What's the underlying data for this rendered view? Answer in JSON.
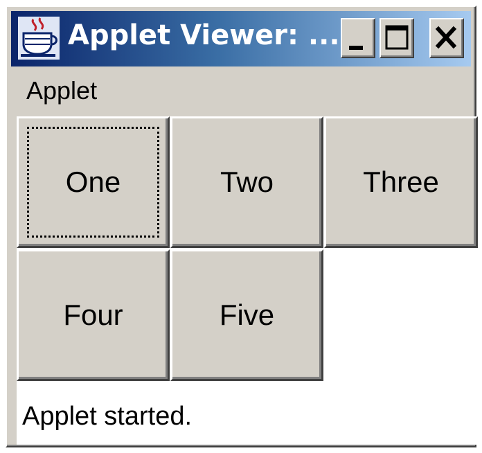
{
  "window": {
    "title": "Applet Viewer: ...",
    "controls": {
      "minimize": "minimize",
      "maximize": "maximize",
      "close": "close"
    }
  },
  "menubar": {
    "items": [
      "Applet"
    ]
  },
  "buttons": [
    {
      "label": "One",
      "focused": true
    },
    {
      "label": "Two",
      "focused": false
    },
    {
      "label": "Three",
      "focused": false
    },
    {
      "label": "Four",
      "focused": false
    },
    {
      "label": "Five",
      "focused": false
    }
  ],
  "status": {
    "text": "Applet started."
  },
  "colors": {
    "face": "#d4d0c8",
    "titlebar_start": "#0a246a",
    "titlebar_end": "#a6caf0",
    "content_bg": "#ffffff"
  },
  "icons": {
    "app": "java-cup-icon"
  }
}
